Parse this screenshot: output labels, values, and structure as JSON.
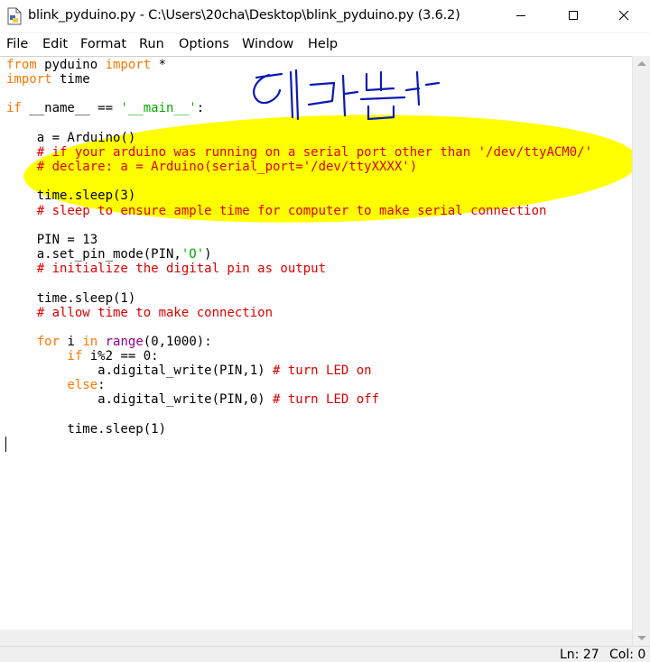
{
  "window": {
    "title": "blink_pyduino.py - C:\\Users\\20cha\\Desktop\\blink_pyduino.py (3.6.2)",
    "controls": [
      "minimize",
      "maximize",
      "close"
    ]
  },
  "menu": [
    "File",
    "Edit",
    "Format",
    "Run",
    "Options",
    "Window",
    "Help"
  ],
  "code": {
    "l1a": "from",
    "l1b": " pyduino ",
    "l1c": "import",
    "l1d": " *",
    "l2a": "import",
    "l2b": " time",
    "l4a": "if",
    "l4b": " __name__ == ",
    "l4c": "'__main__'",
    "l4d": ":",
    "l6": "    a = Arduino()",
    "l7": "    # if your arduino was running on a serial port other than '/dev/ttyACM0/'",
    "l8": "    # declare: a = Arduino(serial_port='/dev/ttyXXXX')",
    "l10": "    time.sleep(3)",
    "l11": "    # sleep to ensure ample time for computer to make serial connection",
    "l13": "    PIN = 13",
    "l14a": "    a.set_pin_mode(PIN,",
    "l14b": "'O'",
    "l14c": ")",
    "l15": "    # initialize the digital pin as output",
    "l17": "    time.sleep(1)",
    "l18": "    # allow time to make connection",
    "l20a": "    for",
    "l20b": " i ",
    "l20c": "in",
    "l20d": " ",
    "l20e": "range",
    "l20f": "(0,1000):",
    "l21a": "        if",
    "l21b": " i%2 == 0:",
    "l22a": "            a.digital_write(PIN,1) ",
    "l22b": "# turn LED on",
    "l23a": "        else",
    "l23b": ":",
    "l24a": "            a.digital_write(PIN,0) ",
    "l24b": "# turn LED off",
    "l26": "        time.sleep(1)"
  },
  "colors": {
    "keyword": "#ff7700",
    "string": "#00aa00",
    "comment": "#dd0000",
    "builtin": "#900090",
    "highlight": "#ffff00",
    "handwriting": "#0a1ab4"
  },
  "status": {
    "line": "Ln: 27",
    "col": "Col: 0"
  }
}
